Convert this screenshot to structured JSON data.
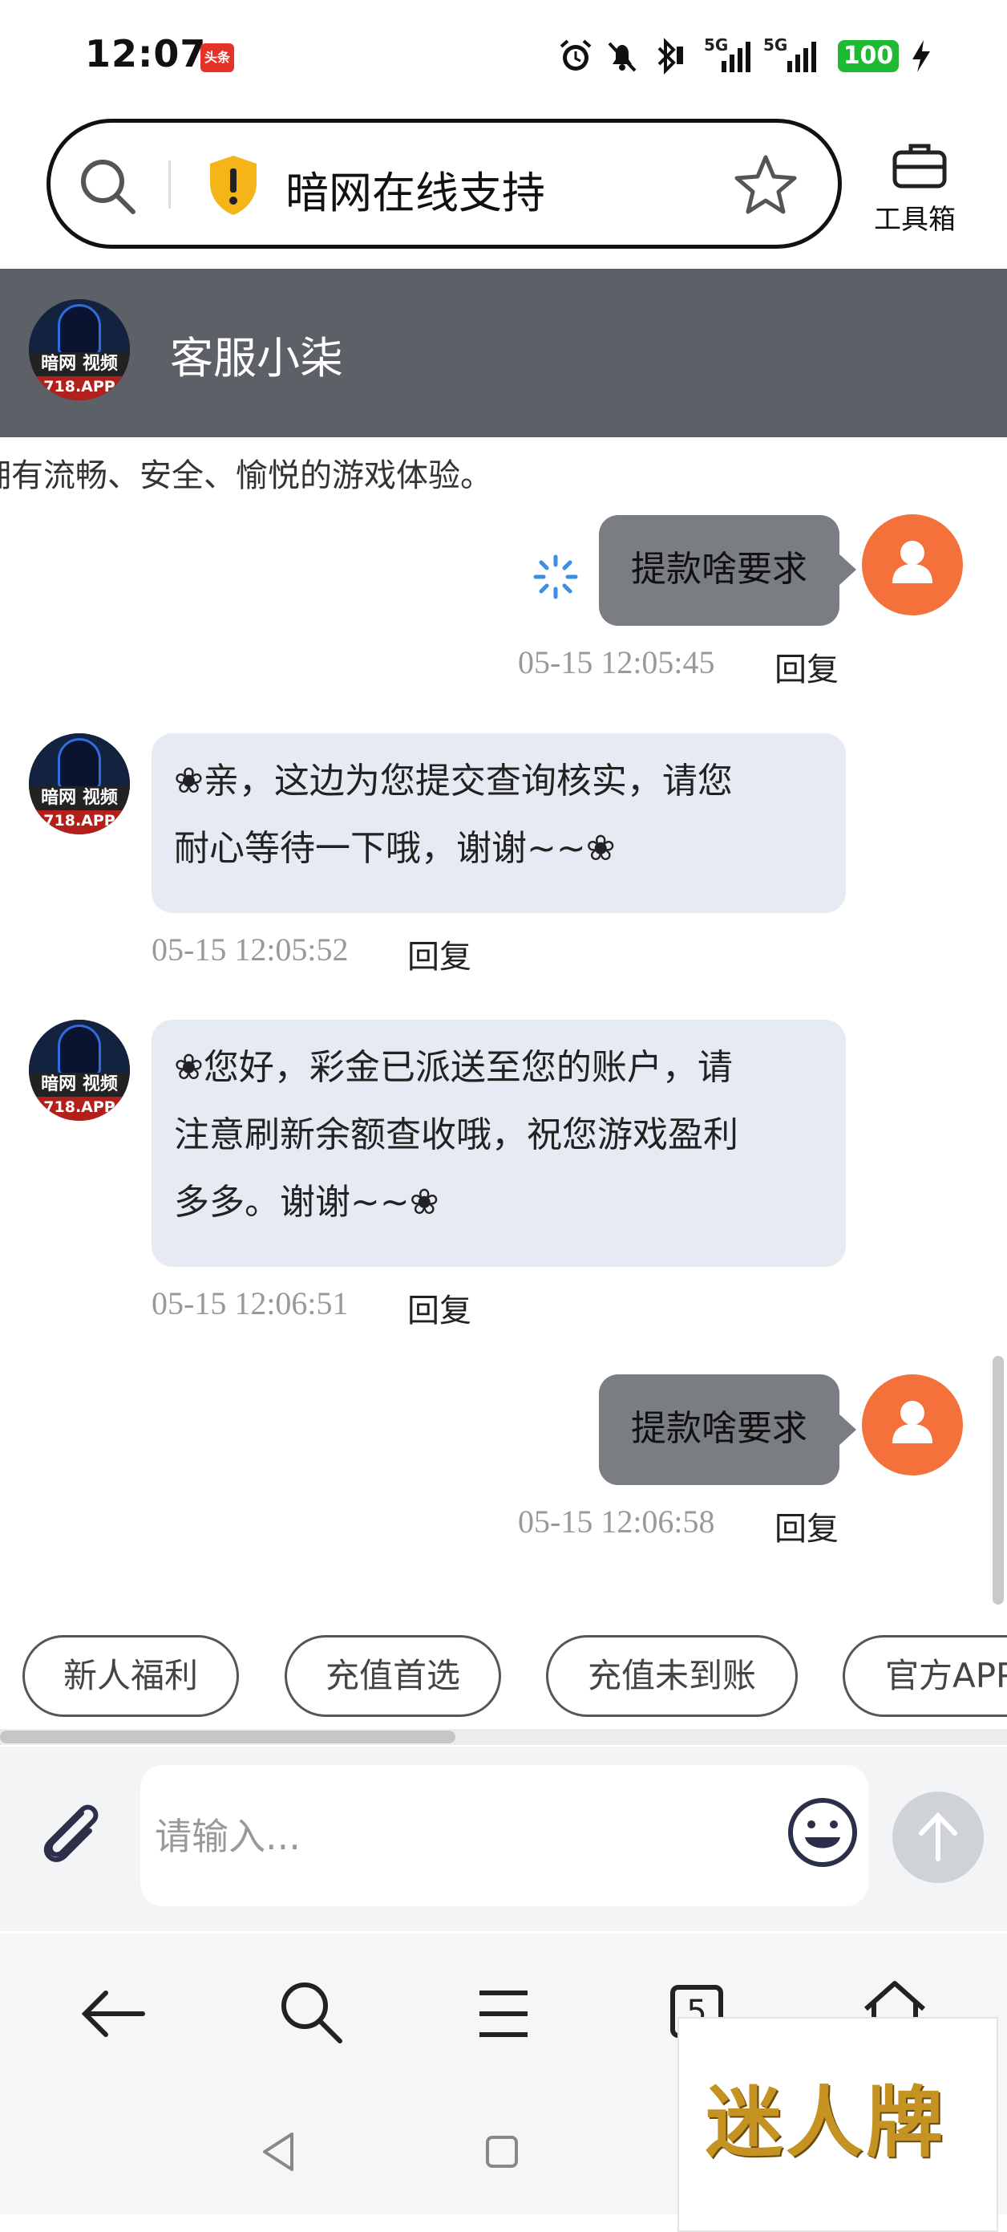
{
  "status_bar": {
    "time": "12:07",
    "news_badge": "头条",
    "signal_1": "5G",
    "signal_2": "5G",
    "battery": "100"
  },
  "address_bar": {
    "title": "暗网在线支持",
    "toolbox_label": "工具箱"
  },
  "chat_header": {
    "agent_name": "客服小柒",
    "avatar_band": "暗网 视频",
    "avatar_site": "718.APP"
  },
  "marquee_text": "拥有流畅、安全、愉悦的游戏体验。",
  "messages": [
    {
      "from": "user",
      "text": "提款啥要求",
      "time": "05-15 12:05:45",
      "reply": "回复",
      "status": "sending"
    },
    {
      "from": "agent",
      "lines": [
        "❀亲，这边为您提交查询核实，请您",
        "耐心等待一下哦，谢谢~~❀"
      ],
      "time": "05-15 12:05:52",
      "reply": "回复"
    },
    {
      "from": "agent",
      "lines": [
        "❀您好，彩金已派送至您的账户，请",
        "注意刷新余额查收哦，祝您游戏盈利",
        "多多。谢谢~~❀"
      ],
      "time": "05-15 12:06:51",
      "reply": "回复"
    },
    {
      "from": "user",
      "text": "提款啥要求",
      "time": "05-15 12:06:58",
      "reply": "回复"
    }
  ],
  "quick_chips": [
    "新人福利",
    "充值首选",
    "充值未到账",
    "官方APP"
  ],
  "input": {
    "placeholder": "请输入..."
  },
  "browser_nav": {
    "tab_count": "5"
  },
  "watermark": "迷人牌",
  "colors": {
    "header_bg": "#5d6066",
    "user_bubble": "#7a7d82",
    "agent_bubble": "#e6eaf2",
    "user_avatar": "#f4713b",
    "battery": "#1fb934"
  }
}
